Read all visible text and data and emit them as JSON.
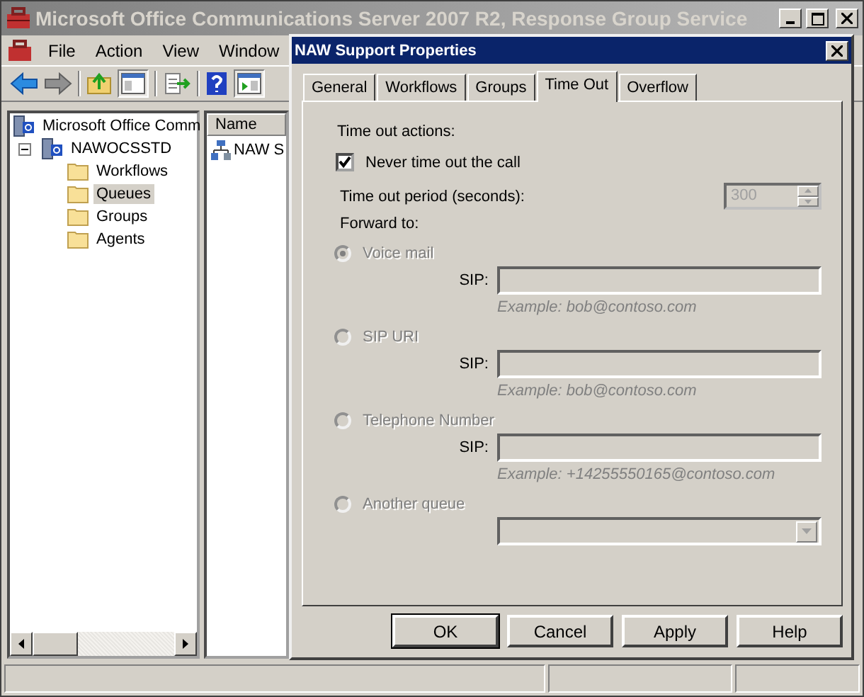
{
  "window": {
    "title": "Microsoft Office Communications Server 2007 R2, Response Group Service"
  },
  "menu": [
    {
      "label": "File"
    },
    {
      "label": "Action"
    },
    {
      "label": "View"
    },
    {
      "label": "Window"
    }
  ],
  "tree": [
    {
      "label": "Microsoft Office Comm",
      "selected": false,
      "children": [
        {
          "label": "NAWOCSSTD",
          "expanded": true,
          "selected": false,
          "children": [
            {
              "label": "Workflows",
              "selected": false
            },
            {
              "label": "Queues",
              "selected": true
            },
            {
              "label": "Groups",
              "selected": false
            },
            {
              "label": "Agents",
              "selected": false
            }
          ]
        }
      ]
    }
  ],
  "list": {
    "columns": [
      "Name"
    ],
    "rows": [
      "NAW S"
    ]
  },
  "dialog": {
    "title": "NAW Support Properties",
    "tabs": [
      {
        "label": "General",
        "selected": false
      },
      {
        "label": "Workflows",
        "selected": false
      },
      {
        "label": "Groups",
        "selected": false
      },
      {
        "label": "Time Out",
        "selected": true
      },
      {
        "label": "Overflow",
        "selected": false
      }
    ],
    "section_label": "Time out actions:",
    "never_timeout": {
      "label": "Never time out the call",
      "checked": true
    },
    "period": {
      "label": "Time out period (seconds):",
      "value": "300",
      "disabled": true
    },
    "forward_label": "Forward to:",
    "options": [
      {
        "kind": "sip",
        "label": "Voice mail",
        "selected": true,
        "disabled": true,
        "field_label": "SIP:",
        "example": "Example: bob@contoso.com"
      },
      {
        "kind": "sip",
        "label": "SIP URI",
        "selected": false,
        "disabled": true,
        "field_label": "SIP:",
        "example": "Example: bob@contoso.com"
      },
      {
        "kind": "sip",
        "label": "Telephone Number",
        "selected": false,
        "disabled": true,
        "field_label": "SIP:",
        "example": "Example: +14255550165@contoso.com"
      },
      {
        "kind": "queue",
        "label": "Another queue",
        "selected": false,
        "disabled": true
      }
    ],
    "buttons": [
      {
        "label": "OK",
        "default": true
      },
      {
        "label": "Cancel",
        "default": false
      },
      {
        "label": "Apply",
        "default": false
      },
      {
        "label": "Help",
        "default": false
      }
    ]
  }
}
